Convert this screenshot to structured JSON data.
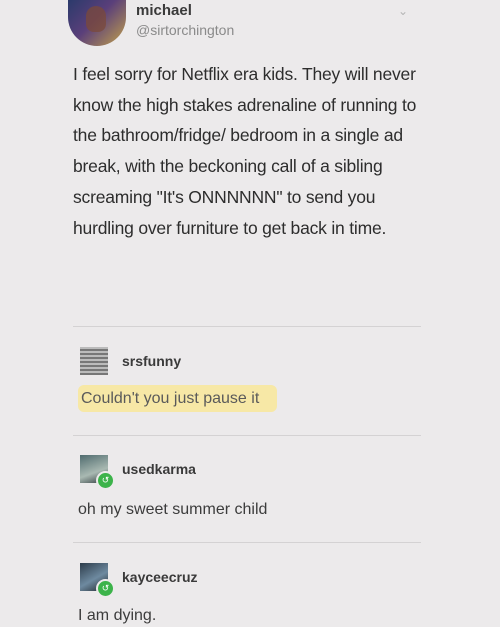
{
  "tweet": {
    "name": "michael",
    "handle": "@sirtorchington",
    "text": "I feel sorry for Netflix era kids. They will never know the high stakes adrenaline of running to the bathroom/fridge/ bedroom in a single ad break, with the beckoning call of a sibling screaming \"It's ONNNNNN\" to send you hurdling over furniture to get back in time."
  },
  "comments": [
    {
      "username": "srsfunny",
      "text": "Couldn't you just pause it"
    },
    {
      "username": "usedkarma",
      "text": "oh my sweet summer child"
    },
    {
      "username": "kayceecruz",
      "text": "I am dying."
    }
  ],
  "icons": {
    "menu": "chevron-down-icon",
    "badge": "follow-badge-icon"
  }
}
